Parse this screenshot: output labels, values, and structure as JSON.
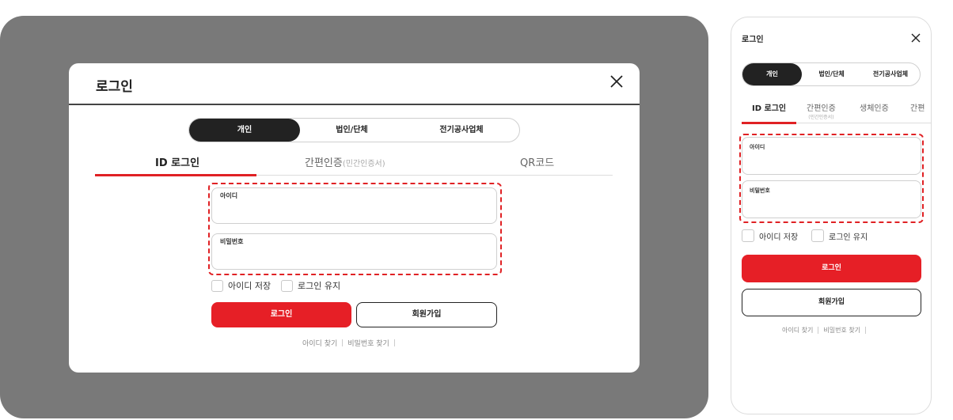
{
  "desktop": {
    "title": "로그인",
    "segments": [
      "개인",
      "법인/단체",
      "전기공사업체"
    ],
    "tabs": {
      "id_login": "ID 로그인",
      "easy_auth": "간편인증",
      "easy_auth_sub": "(민간인증서)",
      "qr": "QR코드"
    },
    "id_placeholder": "아이디",
    "pw_placeholder": "비밀번호",
    "save_id": "아이디 저장",
    "keep_login": "로그인 유지",
    "login_button": "로그인",
    "signup_button": "회원가입",
    "find_id": "아이디 찾기",
    "find_pw": "비밀번호 찾기"
  },
  "mobile": {
    "title": "로그인",
    "segments": [
      "개인",
      "법인/단체",
      "전기공사업체"
    ],
    "tabs": {
      "id_login": "ID 로그인",
      "easy_auth": "간편인증",
      "easy_auth_sub": "(민간인증서)",
      "bio": "생체인증",
      "cut": "간편"
    },
    "id_placeholder": "아이디",
    "pw_placeholder": "비밀번호",
    "save_id": "아이디 저장",
    "keep_login": "로그인 유지",
    "login_button": "로그인",
    "signup_button": "회원가입",
    "find_id": "아이디 찾기",
    "find_pw": "비밀번호 찾기"
  },
  "colors": {
    "accent": "#e02124",
    "overlay": "#797979",
    "dark": "#222222"
  },
  "icons": {
    "close": "close-icon"
  }
}
